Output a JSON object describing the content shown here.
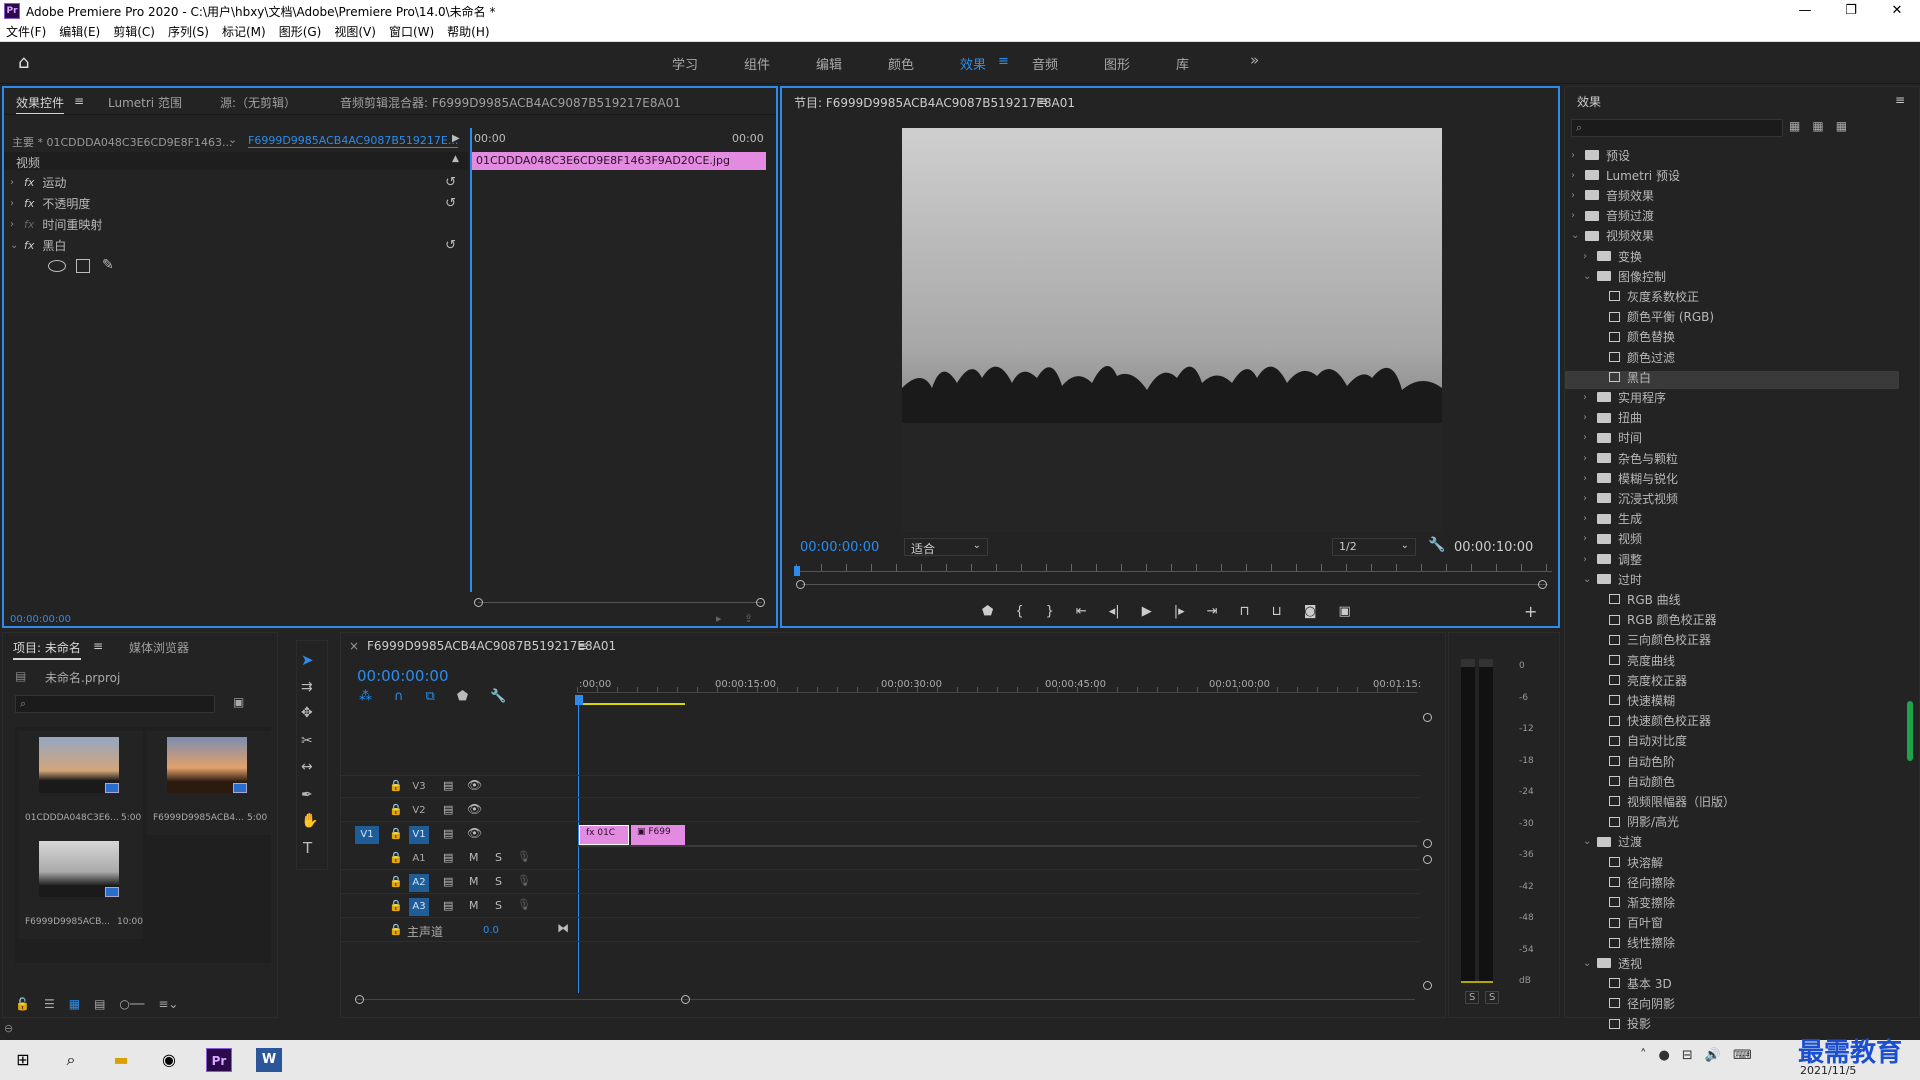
{
  "titlebar": {
    "app": "Adobe Premiere Pro 2020 - C:\\用户\\hbxy\\文档\\Adobe\\Premiere Pro\\14.0\\未命名 *",
    "logo": "Pr"
  },
  "window": {
    "minimize": "—",
    "maximize": "❐",
    "close": "✕"
  },
  "menu": [
    "文件(F)",
    "编辑(E)",
    "剪辑(C)",
    "序列(S)",
    "标记(M)",
    "图形(G)",
    "视图(V)",
    "窗口(W)",
    "帮助(H)"
  ],
  "workspaces": [
    "学习",
    "组件",
    "编辑",
    "颜色",
    "效果",
    "音频",
    "图形",
    "库"
  ],
  "workspace_active": "效果",
  "workspace_more": "»",
  "effect_controls": {
    "tabs": [
      "效果控件",
      "Lumetri 范围",
      "源:（无剪辑）",
      "音频剪辑混合器: F6999D9985ACB4AC9087B519217E8A01"
    ],
    "master": "主要 * 01CDDDA048C3E6CD9E8F1463...",
    "sequence": "F6999D9985ACB4AC9087B519217E...",
    "time_start": "00:00",
    "time_end": "00:00",
    "clip": "01CDDDA048C3E6CD9E8F1463F9AD20CE.jpg",
    "section": "视频",
    "items": [
      "运动",
      "不透明度",
      "时间重映射",
      "黑白"
    ],
    "timecode": "00:00:00:00"
  },
  "program": {
    "title": "节目: F6999D9985ACB4AC9087B519217E8A01",
    "timecode": "00:00:00:00",
    "fit": "适合",
    "quality": "1/2",
    "duration": "00:00:10:00"
  },
  "effects": {
    "title": "效果",
    "tree": [
      {
        "label": "预设",
        "depth": 0,
        "type": "folder-special",
        "open": false
      },
      {
        "label": "Lumetri 预设",
        "depth": 0,
        "type": "folder-special",
        "open": false
      },
      {
        "label": "音频效果",
        "depth": 0,
        "type": "folder",
        "open": false
      },
      {
        "label": "音频过渡",
        "depth": 0,
        "type": "folder",
        "open": false
      },
      {
        "label": "视频效果",
        "depth": 0,
        "type": "folder",
        "open": true
      },
      {
        "label": "变换",
        "depth": 1,
        "type": "folder",
        "open": false
      },
      {
        "label": "图像控制",
        "depth": 1,
        "type": "folder",
        "open": true
      },
      {
        "label": "灰度系数校正",
        "depth": 2,
        "type": "fx"
      },
      {
        "label": "颜色平衡 (RGB)",
        "depth": 2,
        "type": "fx"
      },
      {
        "label": "颜色替换",
        "depth": 2,
        "type": "fx"
      },
      {
        "label": "颜色过滤",
        "depth": 2,
        "type": "fx"
      },
      {
        "label": "黑白",
        "depth": 2,
        "type": "fx",
        "selected": true
      },
      {
        "label": "实用程序",
        "depth": 1,
        "type": "folder",
        "open": false
      },
      {
        "label": "扭曲",
        "depth": 1,
        "type": "folder",
        "open": false
      },
      {
        "label": "时间",
        "depth": 1,
        "type": "folder",
        "open": false
      },
      {
        "label": "杂色与颗粒",
        "depth": 1,
        "type": "folder",
        "open": false
      },
      {
        "label": "模糊与锐化",
        "depth": 1,
        "type": "folder",
        "open": false
      },
      {
        "label": "沉浸式视频",
        "depth": 1,
        "type": "folder",
        "open": false
      },
      {
        "label": "生成",
        "depth": 1,
        "type": "folder",
        "open": false
      },
      {
        "label": "视频",
        "depth": 1,
        "type": "folder",
        "open": false
      },
      {
        "label": "调整",
        "depth": 1,
        "type": "folder",
        "open": false
      },
      {
        "label": "过时",
        "depth": 1,
        "type": "folder",
        "open": true
      },
      {
        "label": "RGB 曲线",
        "depth": 2,
        "type": "fx"
      },
      {
        "label": "RGB 颜色校正器",
        "depth": 2,
        "type": "fx"
      },
      {
        "label": "三向颜色校正器",
        "depth": 2,
        "type": "fx"
      },
      {
        "label": "亮度曲线",
        "depth": 2,
        "type": "fx"
      },
      {
        "label": "亮度校正器",
        "depth": 2,
        "type": "fx"
      },
      {
        "label": "快速模糊",
        "depth": 2,
        "type": "fx"
      },
      {
        "label": "快速颜色校正器",
        "depth": 2,
        "type": "fx"
      },
      {
        "label": "自动对比度",
        "depth": 2,
        "type": "fx"
      },
      {
        "label": "自动色阶",
        "depth": 2,
        "type": "fx"
      },
      {
        "label": "自动颜色",
        "depth": 2,
        "type": "fx"
      },
      {
        "label": "视频限幅器（旧版）",
        "depth": 2,
        "type": "fx"
      },
      {
        "label": "阴影/高光",
        "depth": 2,
        "type": "fx"
      },
      {
        "label": "过渡",
        "depth": 1,
        "type": "folder",
        "open": true
      },
      {
        "label": "块溶解",
        "depth": 2,
        "type": "fx"
      },
      {
        "label": "径向擦除",
        "depth": 2,
        "type": "fx"
      },
      {
        "label": "渐变擦除",
        "depth": 2,
        "type": "fx"
      },
      {
        "label": "百叶窗",
        "depth": 2,
        "type": "fx"
      },
      {
        "label": "线性擦除",
        "depth": 2,
        "type": "fx"
      },
      {
        "label": "透视",
        "depth": 1,
        "type": "folder",
        "open": true
      },
      {
        "label": "基本 3D",
        "depth": 2,
        "type": "fx"
      },
      {
        "label": "径向阴影",
        "depth": 2,
        "type": "fx"
      },
      {
        "label": "投影",
        "depth": 2,
        "type": "fx"
      }
    ]
  },
  "project": {
    "tabs": [
      "项目: 未命名",
      "媒体浏览器"
    ],
    "file": "未命名.prproj",
    "items": [
      {
        "name": "01CDDDA048C3E6...",
        "dur": "5:00"
      },
      {
        "name": "F6999D9985ACB4...",
        "dur": "5:00"
      },
      {
        "name": "F6999D9985ACB...",
        "dur": "10:00"
      }
    ]
  },
  "timeline": {
    "title": "F6999D9985ACB4AC9087B519217E8A01",
    "timecode": "00:00:00:00",
    "ruler": [
      ":00:00",
      "00:00:15:00",
      "00:00:30:00",
      "00:00:45:00",
      "00:01:00:00",
      "00:01:15:"
    ],
    "tracks_video": [
      "V3",
      "V2",
      "V1"
    ],
    "tracks_audio": [
      "A1",
      "A2",
      "A3"
    ],
    "src_v": "V1",
    "master": "主声道",
    "master_val": "0.0",
    "clip1": "01C",
    "clip2": "F699"
  },
  "meter": {
    "scale": [
      "0",
      "-6",
      "-12",
      "-18",
      "-24",
      "-30",
      "-36",
      "-42",
      "-48",
      "-54",
      "dB"
    ],
    "solo": [
      "S",
      "S"
    ]
  },
  "taskbar": {
    "date": "2021/11/5",
    "watermark": "最需教育"
  }
}
